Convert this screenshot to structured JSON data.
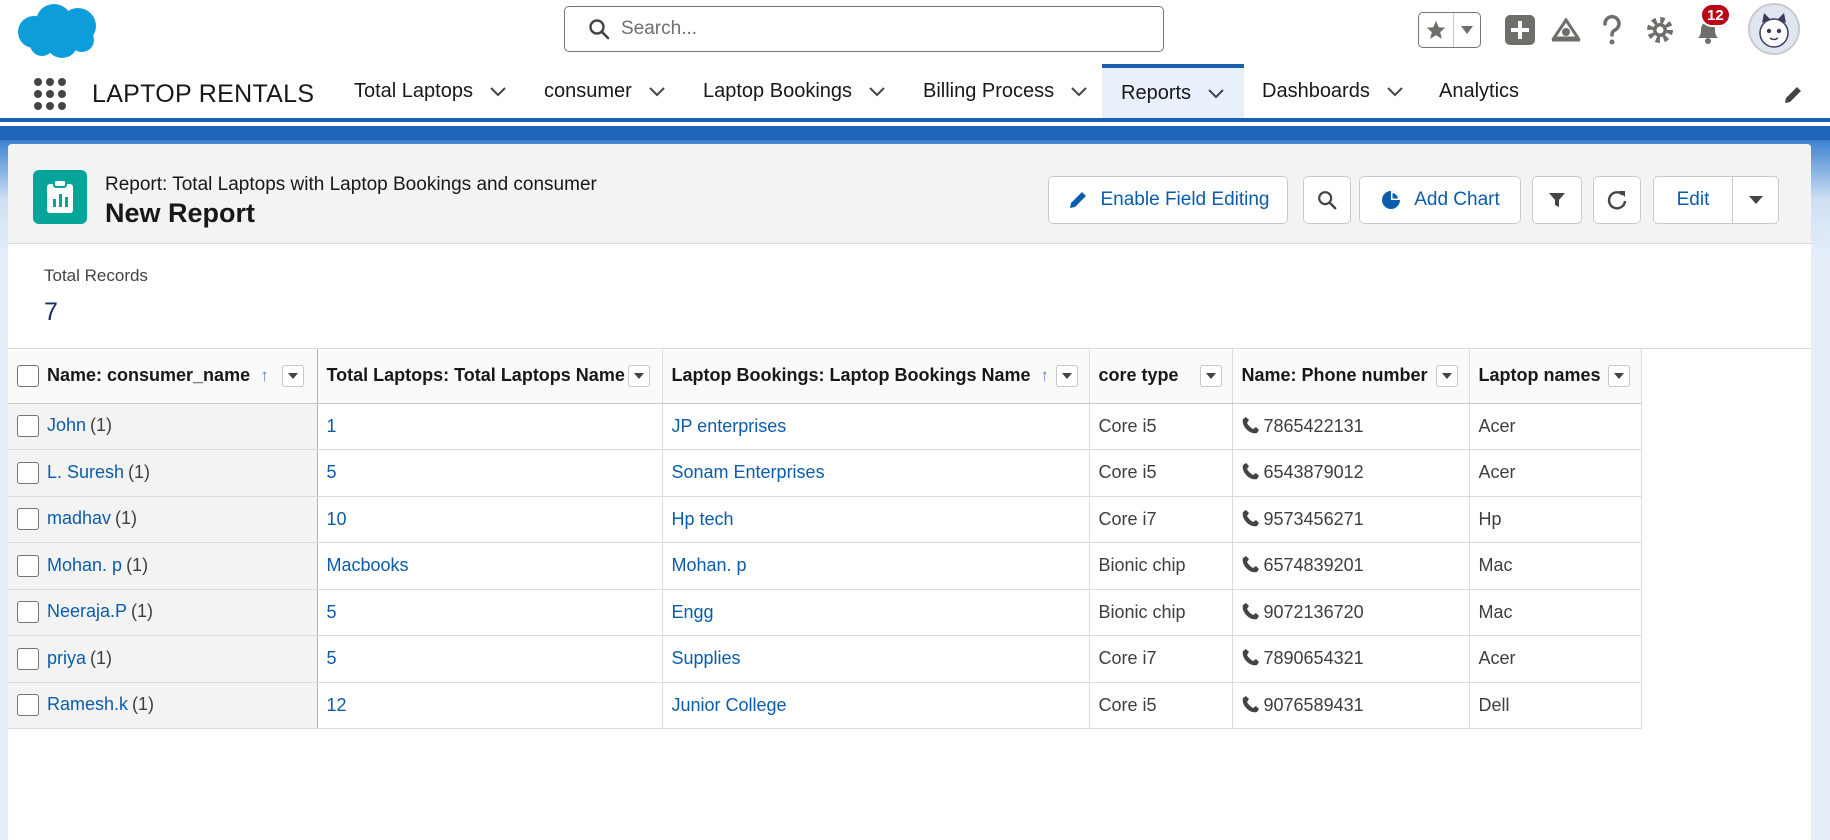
{
  "header": {
    "search_placeholder": "Search...",
    "notification_count": "12"
  },
  "nav": {
    "app_name": "LAPTOP RENTALS",
    "items": [
      {
        "label": "Total Laptops"
      },
      {
        "label": "consumer"
      },
      {
        "label": "Laptop Bookings"
      },
      {
        "label": "Billing Process"
      },
      {
        "label": "Reports"
      },
      {
        "label": "Dashboards"
      },
      {
        "label": "Analytics"
      }
    ],
    "active": "Reports"
  },
  "report": {
    "subtitle": "Report: Total Laptops with Laptop Bookings and consumer",
    "title": "New Report",
    "buttons": {
      "enable_field_editing": "Enable Field Editing",
      "add_chart": "Add Chart",
      "edit": "Edit"
    },
    "total_records_label": "Total Records",
    "total_records_value": "7"
  },
  "table": {
    "columns": [
      "Name: consumer_name",
      "Total Laptops: Total Laptops Name",
      "Laptop Bookings: Laptop Bookings Name",
      "core type",
      "Name: Phone number",
      "Laptop names"
    ],
    "rows": [
      {
        "name": "John",
        "count": "(1)",
        "laptops": "1",
        "booking": "JP enterprises",
        "core": "Core i5",
        "phone": "7865422131",
        "laptop": "Acer"
      },
      {
        "name": "L. Suresh",
        "count": "(1)",
        "laptops": "5",
        "booking": "Sonam Enterprises",
        "core": "Core i5",
        "phone": "6543879012",
        "laptop": "Acer"
      },
      {
        "name": "madhav",
        "count": "(1)",
        "laptops": "10",
        "booking": "Hp tech",
        "core": "Core i7",
        "phone": "9573456271",
        "laptop": "Hp"
      },
      {
        "name": "Mohan. p",
        "count": "(1)",
        "laptops": "Macbooks",
        "booking": "Mohan. p",
        "core": "Bionic chip",
        "phone": "6574839201",
        "laptop": "Mac"
      },
      {
        "name": "Neeraja.P",
        "count": "(1)",
        "laptops": "5",
        "booking": "Engg",
        "core": "Bionic chip",
        "phone": "9072136720",
        "laptop": "Mac"
      },
      {
        "name": "priya",
        "count": "(1)",
        "laptops": "5",
        "booking": "Supplies",
        "core": "Core i7",
        "phone": "7890654321",
        "laptop": "Acer"
      },
      {
        "name": "Ramesh.k",
        "count": "(1)",
        "laptops": "12",
        "booking": "Junior College",
        "core": "Core i5",
        "phone": "9076589431",
        "laptop": "Dell"
      }
    ]
  },
  "colors": {
    "brand_blue": "#0b5cab",
    "report_icon": "#06a59a",
    "notification": "#ba0517",
    "nav_accent": "#1b5fb0"
  }
}
